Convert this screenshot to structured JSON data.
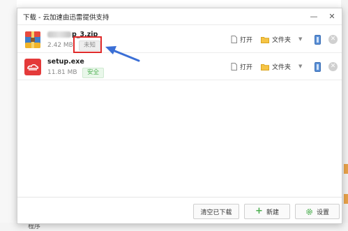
{
  "window": {
    "title": "下载 - 云加速由迅雷提供支持"
  },
  "downloads": [
    {
      "name": "p_3.zip",
      "size": "2.42 MB",
      "status": "未知",
      "icon": "zip-archive-icon",
      "status_color": "#888888"
    },
    {
      "name": "setup.exe",
      "size": "11.81 MB",
      "status": "安全",
      "icon": "app-logo-icon",
      "status_color": "#4caf50"
    }
  ],
  "actions": {
    "open": "打开",
    "folder": "文件夹"
  },
  "footer": {
    "clear": "清空已下载",
    "new": "新建",
    "settings": "设置"
  },
  "background": {
    "bottom_text": "程序"
  },
  "colors": {
    "highlight": "#e02a2a",
    "arrow": "#3b6fd6",
    "safe": "#4caf50",
    "logo": "#e43a3a"
  }
}
